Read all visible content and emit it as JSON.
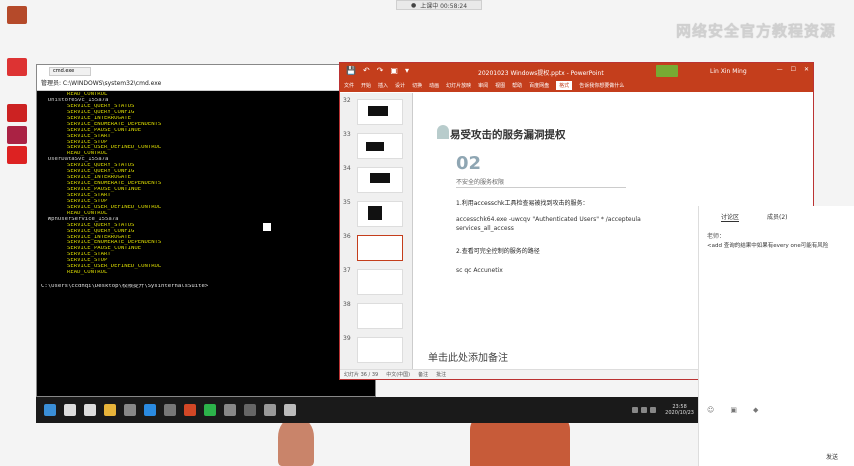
{
  "capture_bar": {
    "label": "上课中 00:58:24"
  },
  "watermark": {
    "text": "网络安全官方教程资源"
  },
  "desktop_icons": [
    {
      "icon": "recycle-bin-icon",
      "color": "#b54a2a"
    },
    {
      "icon": "app-icon",
      "color": "#d33"
    },
    {
      "icon": "folder-icon",
      "color": "#c22"
    },
    {
      "icon": "document-icon",
      "color": "#a24"
    },
    {
      "icon": "browser-icon",
      "color": "#d22"
    }
  ],
  "cmd": {
    "tab_label": "cmd.exe",
    "title": "管理员: C:\\WINDOWS\\system32\\cmd.exe",
    "lines": [
      {
        "t": "perm",
        "text": "READ_CONTROL"
      },
      {
        "t": "hdr",
        "text": "  UnistoreSvc_155a7a"
      },
      {
        "t": "perm",
        "text": "SERVICE_QUERY_STATUS"
      },
      {
        "t": "perm",
        "text": "SERVICE_QUERY_CONFIG"
      },
      {
        "t": "perm",
        "text": "SERVICE_INTERROGATE"
      },
      {
        "t": "perm",
        "text": "SERVICE_ENUMERATE_DEPENDENTS"
      },
      {
        "t": "perm",
        "text": "SERVICE_PAUSE_CONTINUE"
      },
      {
        "t": "perm",
        "text": "SERVICE_START"
      },
      {
        "t": "perm",
        "text": "SERVICE_STOP"
      },
      {
        "t": "perm",
        "text": "SERVICE_USER_DEFINED_CONTROL"
      },
      {
        "t": "perm",
        "text": "READ_CONTROL"
      },
      {
        "t": "hdr",
        "text": "  UserDataSvc_155a7a"
      },
      {
        "t": "perm",
        "text": "SERVICE_QUERY_STATUS"
      },
      {
        "t": "perm",
        "text": "SERVICE_QUERY_CONFIG"
      },
      {
        "t": "perm",
        "text": "SERVICE_INTERROGATE"
      },
      {
        "t": "perm",
        "text": "SERVICE_ENUMERATE_DEPENDENTS"
      },
      {
        "t": "perm",
        "text": "SERVICE_PAUSE_CONTINUE"
      },
      {
        "t": "perm",
        "text": "SERVICE_START"
      },
      {
        "t": "perm",
        "text": "SERVICE_STOP"
      },
      {
        "t": "perm",
        "text": "SERVICE_USER_DEFINED_CONTROL"
      },
      {
        "t": "perm",
        "text": "READ_CONTROL"
      },
      {
        "t": "hdr",
        "text": "  WpnUserService_155a7a"
      },
      {
        "t": "perm",
        "text": "SERVICE_QUERY_STATUS"
      },
      {
        "t": "perm",
        "text": "SERVICE_QUERY_CONFIG"
      },
      {
        "t": "perm",
        "text": "SERVICE_INTERROGATE"
      },
      {
        "t": "perm",
        "text": "SERVICE_ENUMERATE_DEPENDENTS"
      },
      {
        "t": "perm",
        "text": "SERVICE_PAUSE_CONTINUE"
      },
      {
        "t": "perm",
        "text": "SERVICE_START"
      },
      {
        "t": "perm",
        "text": "SERVICE_STOP"
      },
      {
        "t": "perm",
        "text": "SERVICE_USER_DEFINED_CONTROL"
      },
      {
        "t": "perm",
        "text": "READ_CONTROL"
      },
      {
        "t": "blank",
        "text": ""
      },
      {
        "t": "prompt",
        "text": "C:\\Users\\ccdhqi\\Desktop\\权限提升\\SysinternalsSuite>"
      }
    ]
  },
  "taskbar": {
    "icons": [
      "start-icon",
      "search-icon",
      "task-view-icon",
      "file-explorer-icon",
      "app-icon",
      "browser-icon",
      "app-icon",
      "powerpoint-icon",
      "wechat-icon",
      "app-icon",
      "app-icon",
      "app-icon",
      "app-icon"
    ],
    "icon_colors": [
      "#3a8fd8",
      "#ddd",
      "#ddd",
      "#e8b43a",
      "#888",
      "#2a8ae0",
      "#777",
      "#d24726",
      "#2cb34a",
      "#888",
      "#666",
      "#999",
      "#bbb"
    ],
    "clock_time": "23:58",
    "clock_date": "2020/10/23"
  },
  "ppt": {
    "quick_access": [
      "💾",
      "↶",
      "↷",
      "▣",
      "▾"
    ],
    "file_name": "20201023 Windows提权.pptx  -  PowerPoint",
    "user": "Lin Xin Ming",
    "ribbon": [
      "文件",
      "开始",
      "插入",
      "设计",
      "切换",
      "动画",
      "幻灯片放映",
      "审阅",
      "视图",
      "帮助",
      "百度网盘",
      "格式",
      "告诉我你想要做什么"
    ],
    "active_ribbon": "格式",
    "slide_numbers": [
      "32",
      "33",
      "34",
      "35",
      "36",
      "37",
      "38",
      "39"
    ],
    "slide": {
      "title": "易受攻击的服务漏洞提权",
      "number": "02",
      "subtitle": "不安全的服务权限",
      "step1": "1.利用accesschk工具检查易被找到攻击的服务：",
      "cmd1": "accesschk64.exe -uwcqv \"Authenticated Users\" * /accepteula services_all_access",
      "step2": "2.查看可完全控制的服务的路径",
      "cmd2": "sc qc Accunetix"
    },
    "notes_placeholder": "单击此处添加备注",
    "status": [
      "幻灯片 36 / 39",
      "中文(中国)",
      "备注",
      "批注"
    ]
  },
  "side_panel": {
    "tabs": [
      "讨论区",
      "成员(2)"
    ],
    "active_tab": "讨论区",
    "user": "老师：",
    "message": "<add 查询的结果中如果有every one可能有风险",
    "send_label": "发送"
  }
}
